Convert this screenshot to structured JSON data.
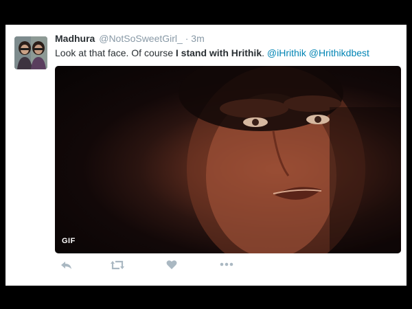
{
  "tweet": {
    "user_name": "Madhura",
    "handle": "@NotSoSweetGirl_",
    "separator": "·",
    "time": "3m",
    "text_plain": "Look at that face. Of course ",
    "text_bold": "I stand with Hrithik",
    "text_after_bold": ". ",
    "mention1": "@iHrithik",
    "mention2": "@Hrithikdbest"
  },
  "media": {
    "badge": "GIF"
  },
  "actions": {
    "reply_icon": "reply-icon",
    "retweet_icon": "retweet-icon",
    "like_icon": "heart-icon",
    "more_icon": "more-icon"
  },
  "colors": {
    "link": "#0084b4",
    "text": "#292f33",
    "secondary": "#8899a6",
    "action_icon": "#aab8c2"
  }
}
